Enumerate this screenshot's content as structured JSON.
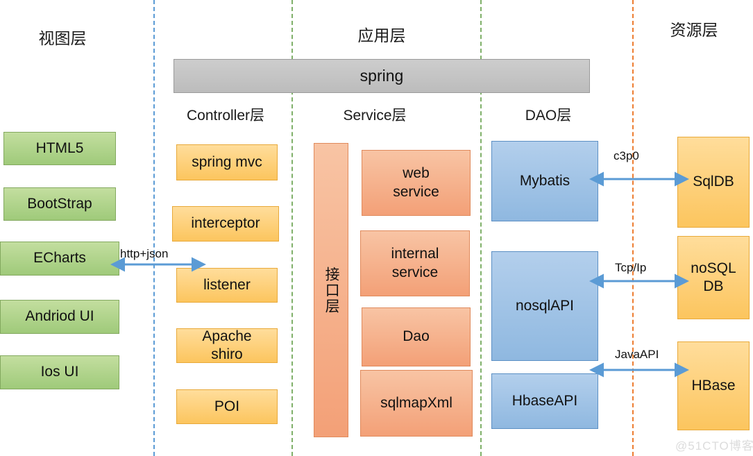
{
  "diagram": {
    "layers": [
      {
        "id": "view",
        "title": "视图层"
      },
      {
        "id": "app",
        "title": "应用层"
      },
      {
        "id": "resource",
        "title": "资源层"
      }
    ],
    "column_titles": [
      {
        "id": "controller",
        "label": "Controller层"
      },
      {
        "id": "service",
        "label": "Service层"
      },
      {
        "id": "dao",
        "label": "DAO层"
      }
    ],
    "spring_bar": {
      "label": "spring"
    },
    "view_layer_nodes": [
      {
        "label": "HTML5"
      },
      {
        "label": "BootStrap"
      },
      {
        "label": "ECharts"
      },
      {
        "label": "Andriod  UI"
      },
      {
        "label": "Ios  UI"
      }
    ],
    "controller_nodes": [
      {
        "label": "spring mvc"
      },
      {
        "label": "interceptor"
      },
      {
        "label": "listener"
      },
      {
        "label": "Apache\nshiro"
      },
      {
        "label": "POI"
      }
    ],
    "service_interface": {
      "label": "接口层"
    },
    "service_nodes": [
      {
        "label": "web\nservice"
      },
      {
        "label": "internal\nservice"
      },
      {
        "label": "Dao"
      },
      {
        "label": "sqlmapXml"
      }
    ],
    "dao_nodes": [
      {
        "label": "Mybatis"
      },
      {
        "label": "nosqlAPI"
      },
      {
        "label": "HbaseAPI"
      }
    ],
    "resource_nodes": [
      {
        "label": "SqlDB"
      },
      {
        "label": "noSQL\nDB"
      },
      {
        "label": "HBase"
      }
    ],
    "connections": [
      {
        "id": "view-controller",
        "label": "http+json"
      },
      {
        "id": "mybatis-sqldb",
        "label": "c3p0"
      },
      {
        "id": "nosql-nosqldb",
        "label": "Tcp/Ip"
      },
      {
        "id": "hbase-hbasedb",
        "label": "JavaAPI"
      }
    ],
    "watermark": "@51CTO博客",
    "colors": {
      "view_node": "#9fca7a",
      "controller_node": "#fcc55e",
      "service_node": "#f3a077",
      "dao_node": "#8fb8e0",
      "resource_node": "#fcc55e",
      "spring_bar": "#bcbcbc",
      "arrow": "#5b9bd5",
      "divider_blue": "#5b9bd5",
      "divider_green": "#7fb069",
      "divider_orange": "#ed7d31"
    }
  }
}
